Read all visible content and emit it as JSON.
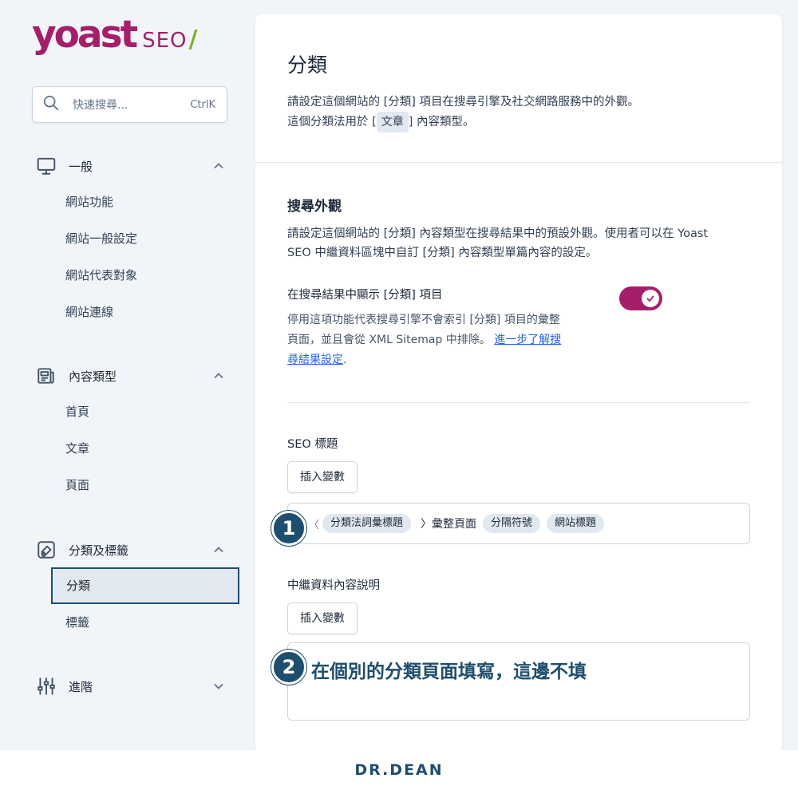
{
  "logo": {
    "wordmark": "yoast",
    "product": "SEO",
    "slash": "/"
  },
  "search": {
    "placeholder": "快速搜尋...",
    "shortcut": "CtrlK"
  },
  "sidebar": {
    "groups": [
      {
        "label": "一般",
        "icon": "desktop-icon",
        "expanded": true,
        "items": [
          "網站功能",
          "網站一般設定",
          "網站代表對象",
          "網站連線"
        ]
      },
      {
        "label": "內容類型",
        "icon": "newspaper-icon",
        "expanded": true,
        "items": [
          "首頁",
          "文章",
          "頁面"
        ]
      },
      {
        "label": "分類及標籤",
        "icon": "tag-folder-icon",
        "expanded": true,
        "items": [
          "分類",
          "標籤"
        ],
        "active": "分類"
      },
      {
        "label": "進階",
        "icon": "sliders-icon",
        "expanded": false,
        "items": []
      }
    ]
  },
  "main": {
    "title": "分類",
    "desc_line1": "請設定這個網站的 [分類] 項目在搜尋引擎及社交網路服務中的外觀。",
    "desc_line2_pre": "這個分類法用於 [",
    "desc_tag": "文章",
    "desc_line2_post": "] 內容類型。",
    "search_appearance": {
      "title": "搜尋外觀",
      "desc_line1": "請設定這個網站的 [分類] 內容類型在搜尋結果中的預設外觀。使用者可以在 Yoast",
      "desc_line2": "SEO 中繼資料區塊中自訂 [分類] 內容類型單篇內容的設定。",
      "toggle": {
        "label": "在搜尋結果中顯示 [分類] 項目",
        "checked": true,
        "help_line1": "停用這項功能代表搜尋引擎不會索引 [分類] 項目的彙整",
        "help_line2": "頁面，並且會從 XML Sitemap 中排除。",
        "link_part1": "進一步了解搜",
        "link_part2": "尋結果設定",
        "link_end": "."
      }
    },
    "seo_title": {
      "label": "SEO 標題",
      "insert_button": "插入變數",
      "bracket": "〈",
      "tokens": [
        "分類法詞彙標題",
        "〉彙整頁面",
        "分隔符號",
        "網站標題"
      ]
    },
    "meta_desc": {
      "label": "中繼資料內容說明",
      "insert_button": "插入變數",
      "value": ""
    }
  },
  "annotations": {
    "badge1": "1",
    "badge2": "2",
    "note": "在個別的分類頁面填寫，這邊不填"
  },
  "brand": "DR.DEAN",
  "colors": {
    "accent": "#a61e69",
    "navy": "#1e4e6e",
    "green": "#77b227"
  }
}
